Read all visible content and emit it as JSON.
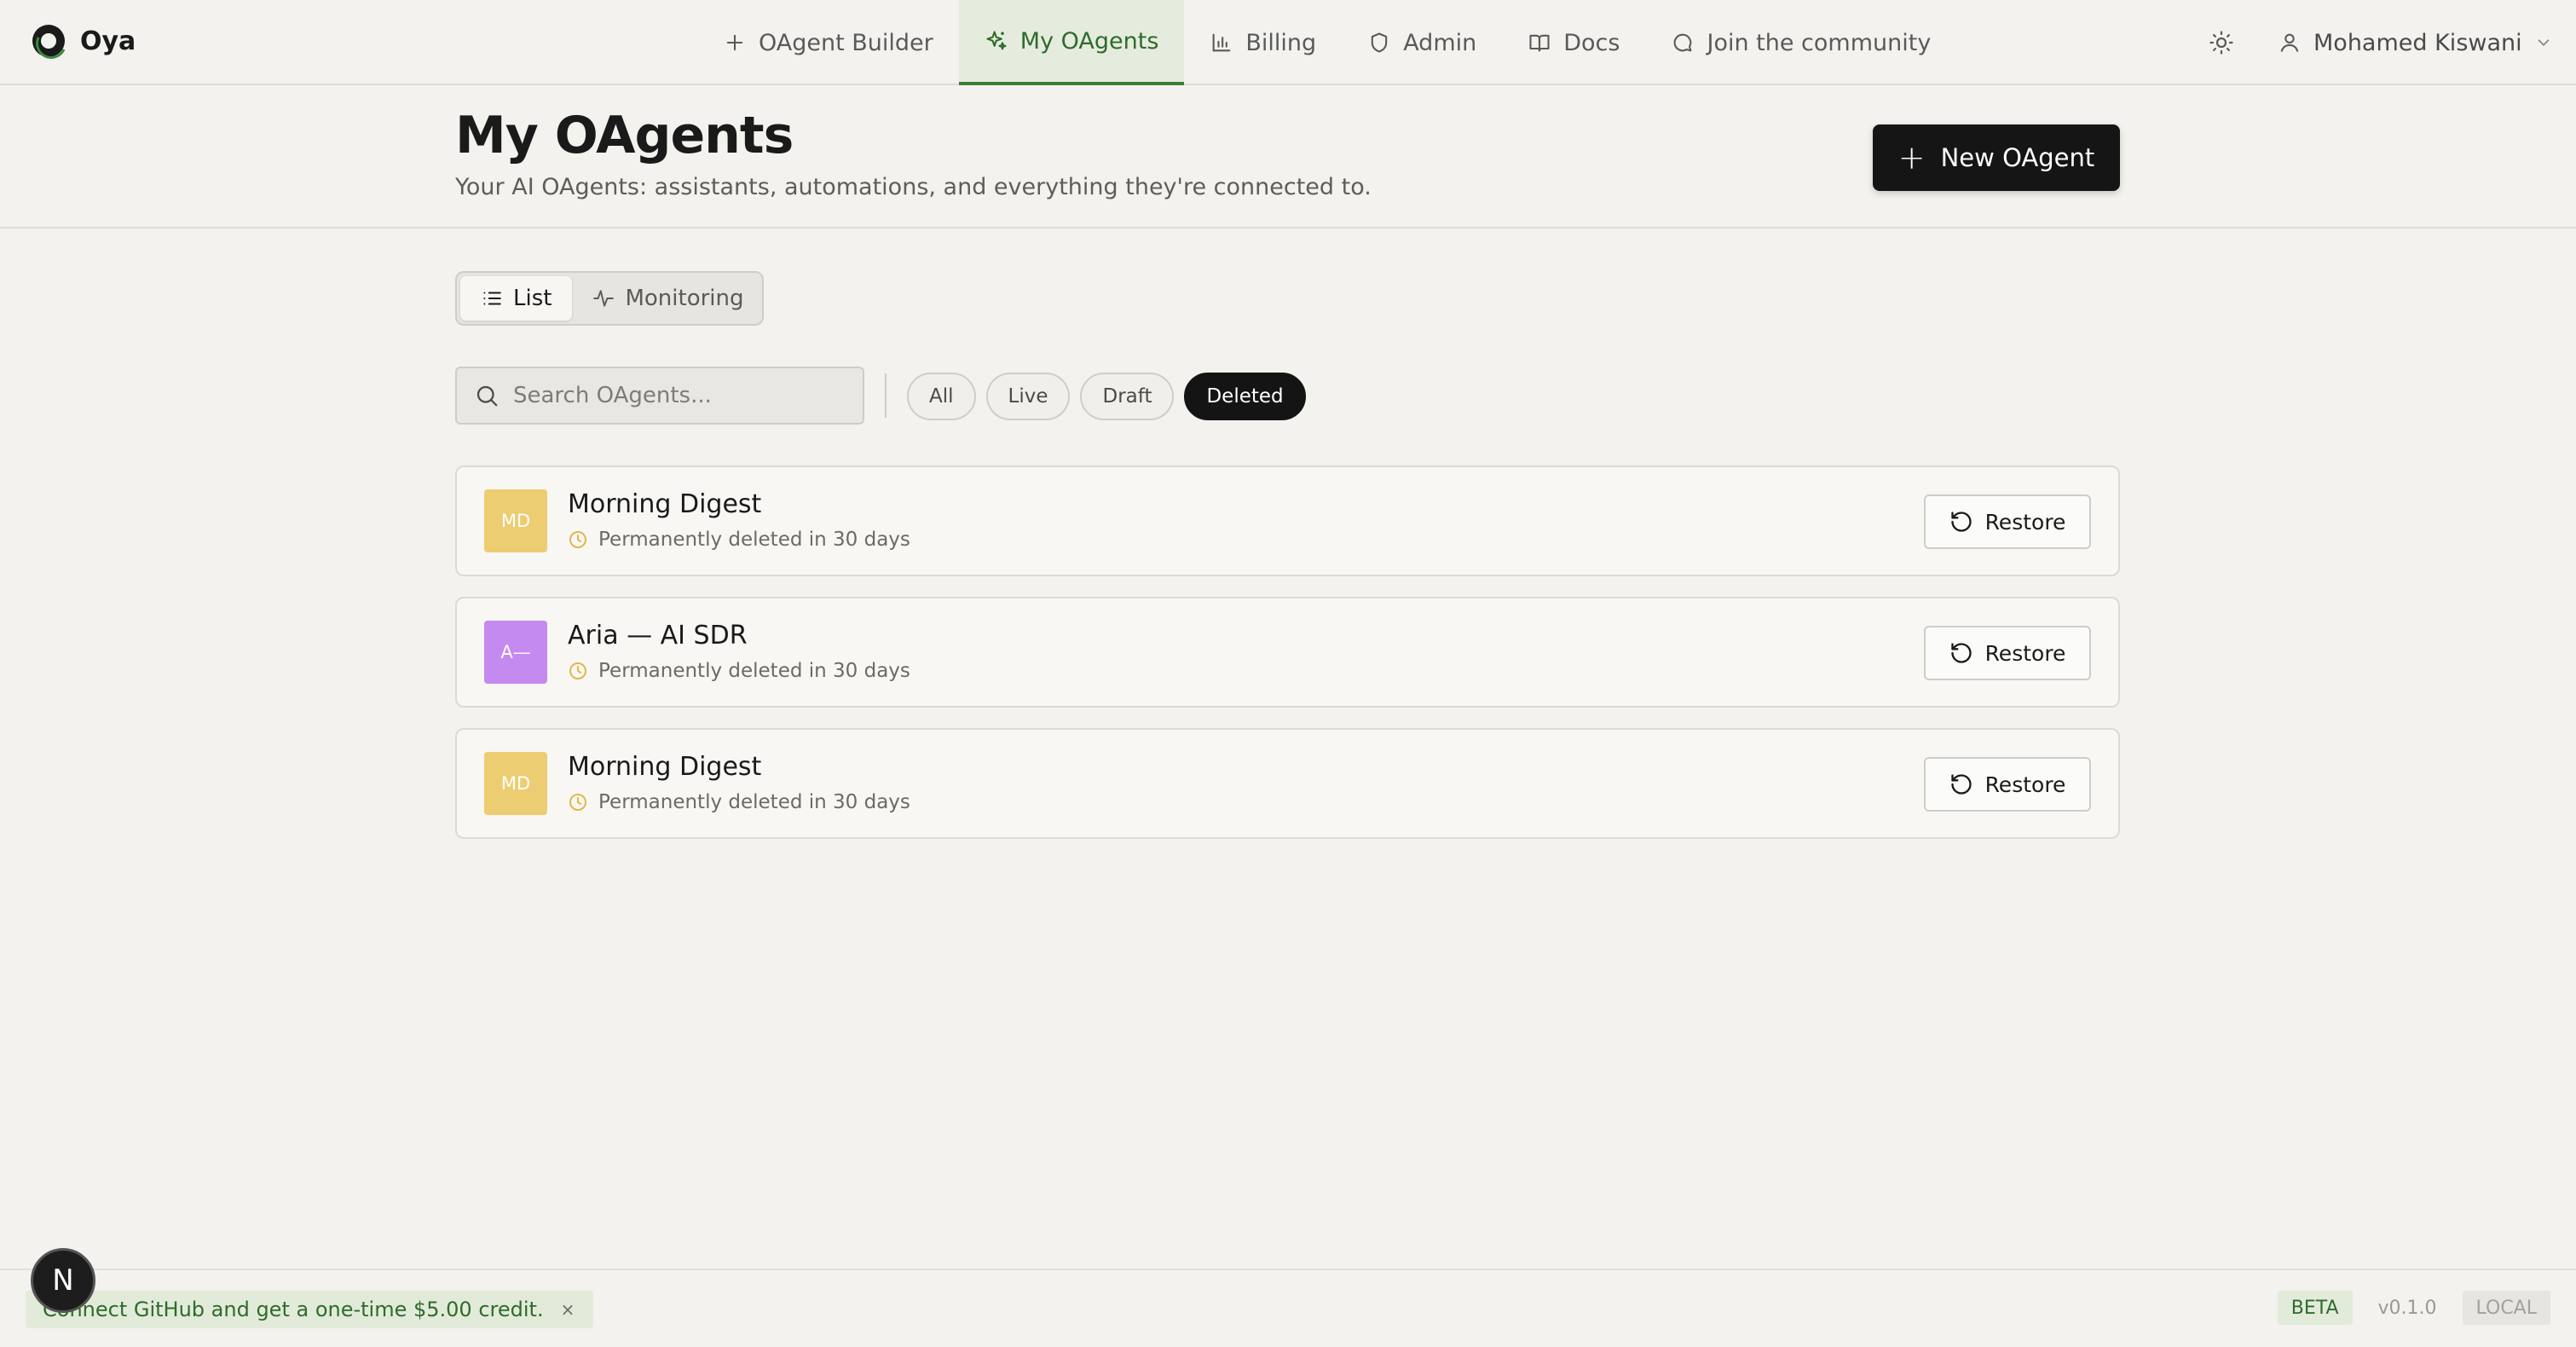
{
  "brand": {
    "name": "Oya"
  },
  "nav": {
    "tabs": [
      {
        "label": "OAgent Builder",
        "icon": "plus-icon"
      },
      {
        "label": "My OAgents",
        "icon": "sparkles-icon",
        "active": true
      },
      {
        "label": "Billing",
        "icon": "bar-chart-icon"
      },
      {
        "label": "Admin",
        "icon": "shield-icon"
      },
      {
        "label": "Docs",
        "icon": "book-icon"
      },
      {
        "label": "Join the community",
        "icon": "chat-bubble-icon"
      }
    ],
    "theme_icon": "sun-icon",
    "user_name": "Mohamed Kiswani"
  },
  "header": {
    "title": "My OAgents",
    "subtitle": "Your AI OAgents: assistants, automations, and everything they're connected to.",
    "new_button": "New OAgent"
  },
  "view_toggle": {
    "list": "List",
    "monitoring": "Monitoring",
    "selected": "List"
  },
  "search": {
    "placeholder": "Search OAgents...",
    "value": ""
  },
  "filters": {
    "items": [
      "All",
      "Live",
      "Draft",
      "Deleted"
    ],
    "selected": "Deleted"
  },
  "agents": [
    {
      "initials": "MD",
      "name": "Morning Digest",
      "status": "Permanently deleted in 30 days",
      "avatar_color": "#edcd71",
      "action": "Restore"
    },
    {
      "initials": "A—",
      "name": "Aria — AI SDR",
      "status": "Permanently deleted in 30 days",
      "avatar_color": "#c48af0",
      "action": "Restore"
    },
    {
      "initials": "MD",
      "name": "Morning Digest",
      "status": "Permanently deleted in 30 days",
      "avatar_color": "#edcd71",
      "action": "Restore"
    }
  ],
  "footer": {
    "promo": "Connect GitHub and get a one-time $5.00 credit.",
    "promo_close": "×",
    "badge": "N",
    "tags": {
      "beta": "BETA",
      "version": "v0.1.0",
      "env": "LOCAL"
    }
  },
  "colors": {
    "accent_green": "#2f6b2c",
    "primary_black": "#151515",
    "background": "#f3f2ee"
  }
}
